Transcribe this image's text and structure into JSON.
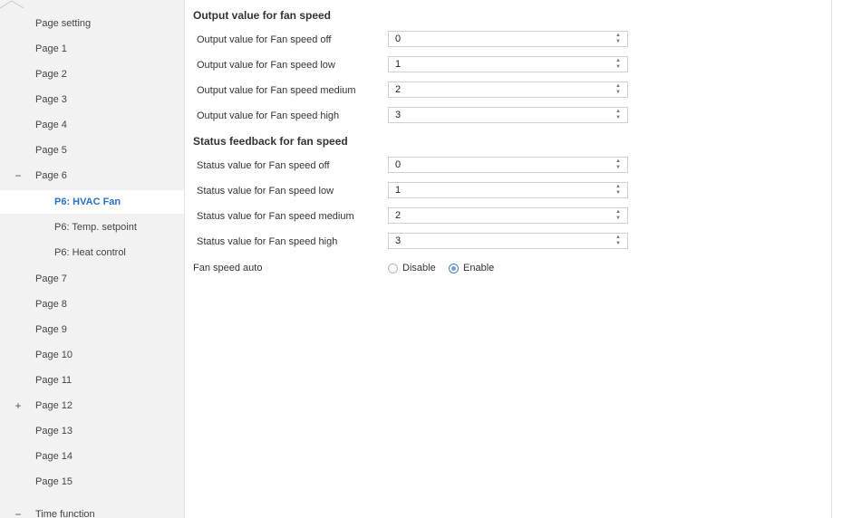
{
  "sidebar": {
    "items": [
      {
        "label": "Page setting",
        "expander": ""
      },
      {
        "label": "Page 1",
        "expander": ""
      },
      {
        "label": "Page 2",
        "expander": ""
      },
      {
        "label": "Page 3",
        "expander": ""
      },
      {
        "label": "Page 4",
        "expander": ""
      },
      {
        "label": "Page 5",
        "expander": ""
      },
      {
        "label": "Page 6",
        "expander": "−"
      },
      {
        "label": "P6: HVAC Fan",
        "expander": ""
      },
      {
        "label": "P6: Temp. setpoint",
        "expander": ""
      },
      {
        "label": "P6: Heat control",
        "expander": ""
      },
      {
        "label": "Page 7",
        "expander": ""
      },
      {
        "label": "Page 8",
        "expander": ""
      },
      {
        "label": "Page 9",
        "expander": ""
      },
      {
        "label": "Page 10",
        "expander": ""
      },
      {
        "label": "Page 11",
        "expander": ""
      },
      {
        "label": "Page 12",
        "expander": "+"
      },
      {
        "label": "Page 13",
        "expander": ""
      },
      {
        "label": "Page 14",
        "expander": ""
      },
      {
        "label": "Page 15",
        "expander": ""
      },
      {
        "label": "Time function",
        "expander": "−"
      }
    ],
    "active_item": "P6: HVAC Fan"
  },
  "main": {
    "output_section": {
      "title": "Output value for fan speed",
      "rows": [
        {
          "label": "Output value for Fan speed off",
          "value": "0"
        },
        {
          "label": "Output value for Fan speed low",
          "value": "1"
        },
        {
          "label": "Output value for Fan speed medium",
          "value": "2"
        },
        {
          "label": "Output value for Fan speed high",
          "value": "3"
        }
      ]
    },
    "status_section": {
      "title": "Status feedback for fan speed",
      "rows": [
        {
          "label": "Status value for Fan speed off",
          "value": "0"
        },
        {
          "label": "Status value for Fan speed low",
          "value": "1"
        },
        {
          "label": "Status value for Fan speed medium",
          "value": "2"
        },
        {
          "label": "Status value for Fan speed high",
          "value": "3"
        }
      ]
    },
    "fan_speed_auto": {
      "label": "Fan speed auto",
      "options": [
        "Disable",
        "Enable"
      ],
      "selected": "Enable"
    }
  },
  "colors": {
    "accent": "#2a6fc9",
    "sidebar_bg": "#f2f2f2"
  }
}
